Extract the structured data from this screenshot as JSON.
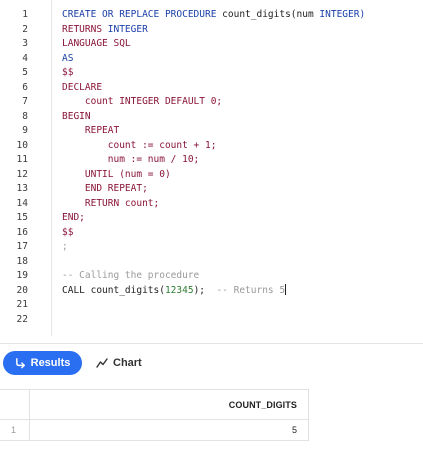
{
  "editor": {
    "line_numbers": [
      "1",
      "2",
      "3",
      "4",
      "5",
      "6",
      "7",
      "8",
      "9",
      "10",
      "11",
      "12",
      "13",
      "14",
      "15",
      "16",
      "17",
      "18",
      "19",
      "20",
      "21",
      "22"
    ],
    "lines": [
      [
        {
          "t": "CREATE OR REPLACE PROCEDURE",
          "c": "kw"
        },
        {
          "t": " count_digits(",
          "c": "id"
        },
        {
          "t": "num",
          "c": "id"
        },
        {
          "t": " INTEGER)",
          "c": "kw"
        }
      ],
      [
        {
          "t": "RETURNS ",
          "c": "kw2"
        },
        {
          "t": "INTEGER",
          "c": "kw"
        }
      ],
      [
        {
          "t": "LANGUAGE SQL",
          "c": "kw2"
        }
      ],
      [
        {
          "t": "AS",
          "c": "kw"
        }
      ],
      [
        {
          "t": "$$",
          "c": "kw2"
        }
      ],
      [
        {
          "t": "DECLARE",
          "c": "kw2"
        }
      ],
      [
        {
          "t": "    count INTEGER DEFAULT 0;",
          "c": "kw2"
        }
      ],
      [
        {
          "t": "BEGIN",
          "c": "kw2"
        }
      ],
      [
        {
          "t": "    REPEAT",
          "c": "kw2"
        }
      ],
      [
        {
          "t": "        count := count + 1;",
          "c": "kw2"
        }
      ],
      [
        {
          "t": "        num := num / 10;",
          "c": "kw2"
        }
      ],
      [
        {
          "t": "    UNTIL (num = 0)",
          "c": "kw2"
        }
      ],
      [
        {
          "t": "    END REPEAT;",
          "c": "kw2"
        }
      ],
      [
        {
          "t": "    RETURN count;",
          "c": "kw2"
        }
      ],
      [
        {
          "t": "END;",
          "c": "kw2"
        }
      ],
      [
        {
          "t": "$$",
          "c": "kw2"
        }
      ],
      [
        {
          "t": ";",
          "c": "cmt"
        }
      ],
      [],
      [
        {
          "t": "-- Calling the procedure",
          "c": "cmt"
        }
      ],
      [
        {
          "t": "CALL count_digits(",
          "c": "id"
        },
        {
          "t": "12345",
          "c": "num"
        },
        {
          "t": ");  ",
          "c": "id"
        },
        {
          "t": "-- Returns 5",
          "c": "cmt"
        }
      ],
      [],
      []
    ]
  },
  "tabs": {
    "results_label": "Results",
    "chart_label": "Chart"
  },
  "results": {
    "columns": [
      "COUNT_DIGITS"
    ],
    "rows": [
      {
        "row_number": "1",
        "values": [
          "5"
        ]
      }
    ]
  },
  "colors": {
    "accent": "#2a6ef2",
    "keyword_blue": "#1a3fa8",
    "keyword_red": "#8a1538",
    "number_green": "#2e7d32",
    "comment_gray": "#9a9a9a"
  }
}
